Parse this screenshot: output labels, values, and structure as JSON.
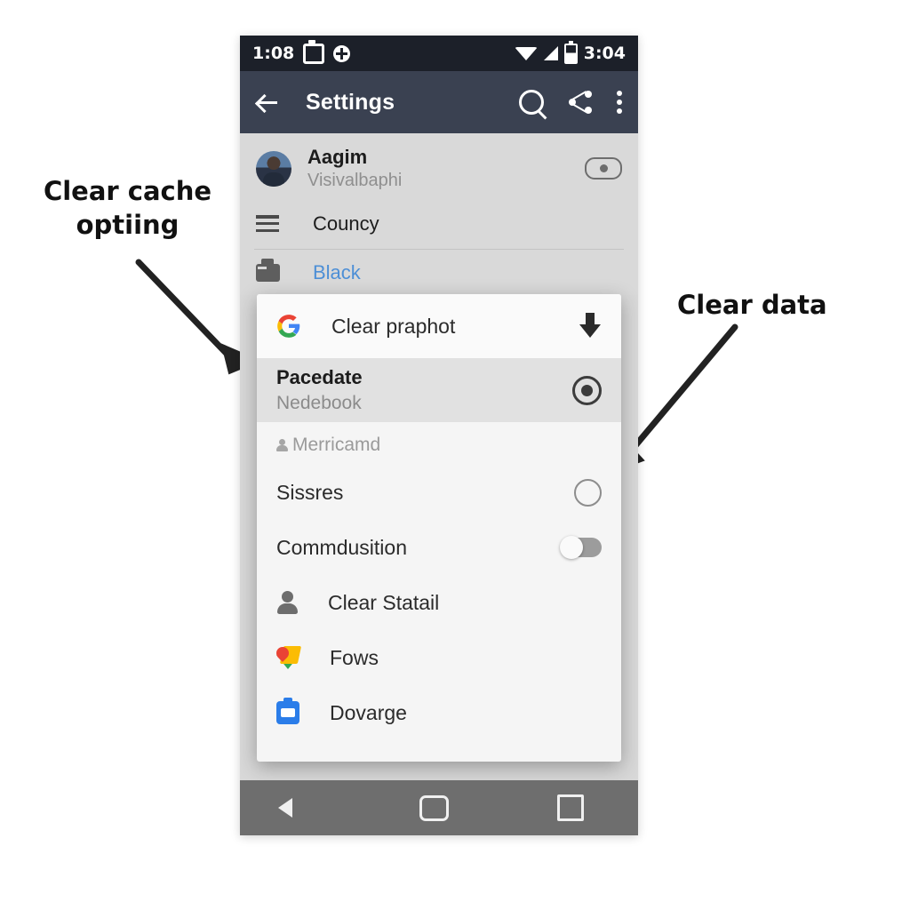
{
  "annotations": {
    "left": "Clear cache optiing",
    "right": "Clear data"
  },
  "phone": {
    "status_bar": {
      "time_left": "1:08",
      "time_right": "3:04",
      "icons_left": [
        "cast-icon",
        "plus-circle-icon"
      ],
      "icons_right": [
        "wifi-icon",
        "signal-icon",
        "battery-icon"
      ]
    },
    "app_bar": {
      "back_icon": "back-arrow-icon",
      "title": "Settings",
      "actions": [
        "search-icon",
        "share-icon",
        "overflow-menu-icon"
      ]
    },
    "background_list": {
      "profile": {
        "name": "Aagim",
        "subtitle": "Visivalbaphi",
        "avatar": "avatar-photo",
        "chip": "toggle-chip"
      },
      "rows": [
        {
          "icon": "hamburger-icon",
          "label": "Councy"
        },
        {
          "icon": "briefcase-icon",
          "label": "Black",
          "color": "#4d8fd6"
        }
      ]
    },
    "dialog": {
      "rows": [
        {
          "icon": "google-logo-icon",
          "label": "Clear praphot",
          "trailing": "download-icon",
          "style": "first"
        },
        {
          "title": "Pacedate",
          "subtitle": "Nedebook",
          "trailing": "radio-selected",
          "style": "highlight"
        },
        {
          "section": "Merricamd",
          "icon": "person-small-icon"
        },
        {
          "label": "Sissres",
          "trailing": "radio-unselected"
        },
        {
          "label": "Commdusition",
          "trailing": "switch-off"
        },
        {
          "icon": "person-icon",
          "label": "Clear Statail"
        },
        {
          "icon": "google-maps-icon",
          "label": "Fows"
        },
        {
          "icon": "blue-camera-icon",
          "label": "Dovarge"
        }
      ]
    },
    "nav_bar": {
      "back": "nav-back-icon",
      "home": "nav-home-icon",
      "recents": "nav-recents-icon"
    }
  },
  "colors": {
    "status_bar": "#1c2029",
    "app_bar": "#3a4151",
    "accent_blue": "#4d8fd6",
    "nav_bar": "#6e6e6e",
    "dialog_bg": "#f5f5f5",
    "highlight_row": "#e1e1e1"
  }
}
